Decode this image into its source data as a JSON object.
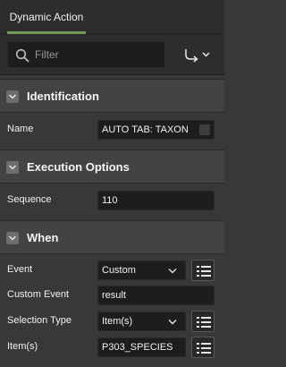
{
  "tabs": [
    {
      "label": "Dynamic Action"
    }
  ],
  "colors": {
    "accent": "#6e9b5a"
  },
  "search": {
    "placeholder": "Filter",
    "icon": "search-icon"
  },
  "toolbar": {
    "goto_icon": "goto-component-icon"
  },
  "sections": {
    "identification": {
      "title": "Identification",
      "fields": {
        "name": {
          "label": "Name",
          "value": "AUTO TAB: TAXON"
        }
      }
    },
    "execution": {
      "title": "Execution Options",
      "fields": {
        "sequence": {
          "label": "Sequence",
          "value": "110"
        }
      }
    },
    "when": {
      "title": "When",
      "fields": {
        "event": {
          "label": "Event",
          "value": "Custom"
        },
        "custom_event": {
          "label": "Custom Event",
          "value": "result"
        },
        "selection_type": {
          "label": "Selection Type",
          "value": "Item(s)"
        },
        "items": {
          "label": "Item(s)",
          "value": "P303_SPECIES"
        }
      }
    }
  }
}
